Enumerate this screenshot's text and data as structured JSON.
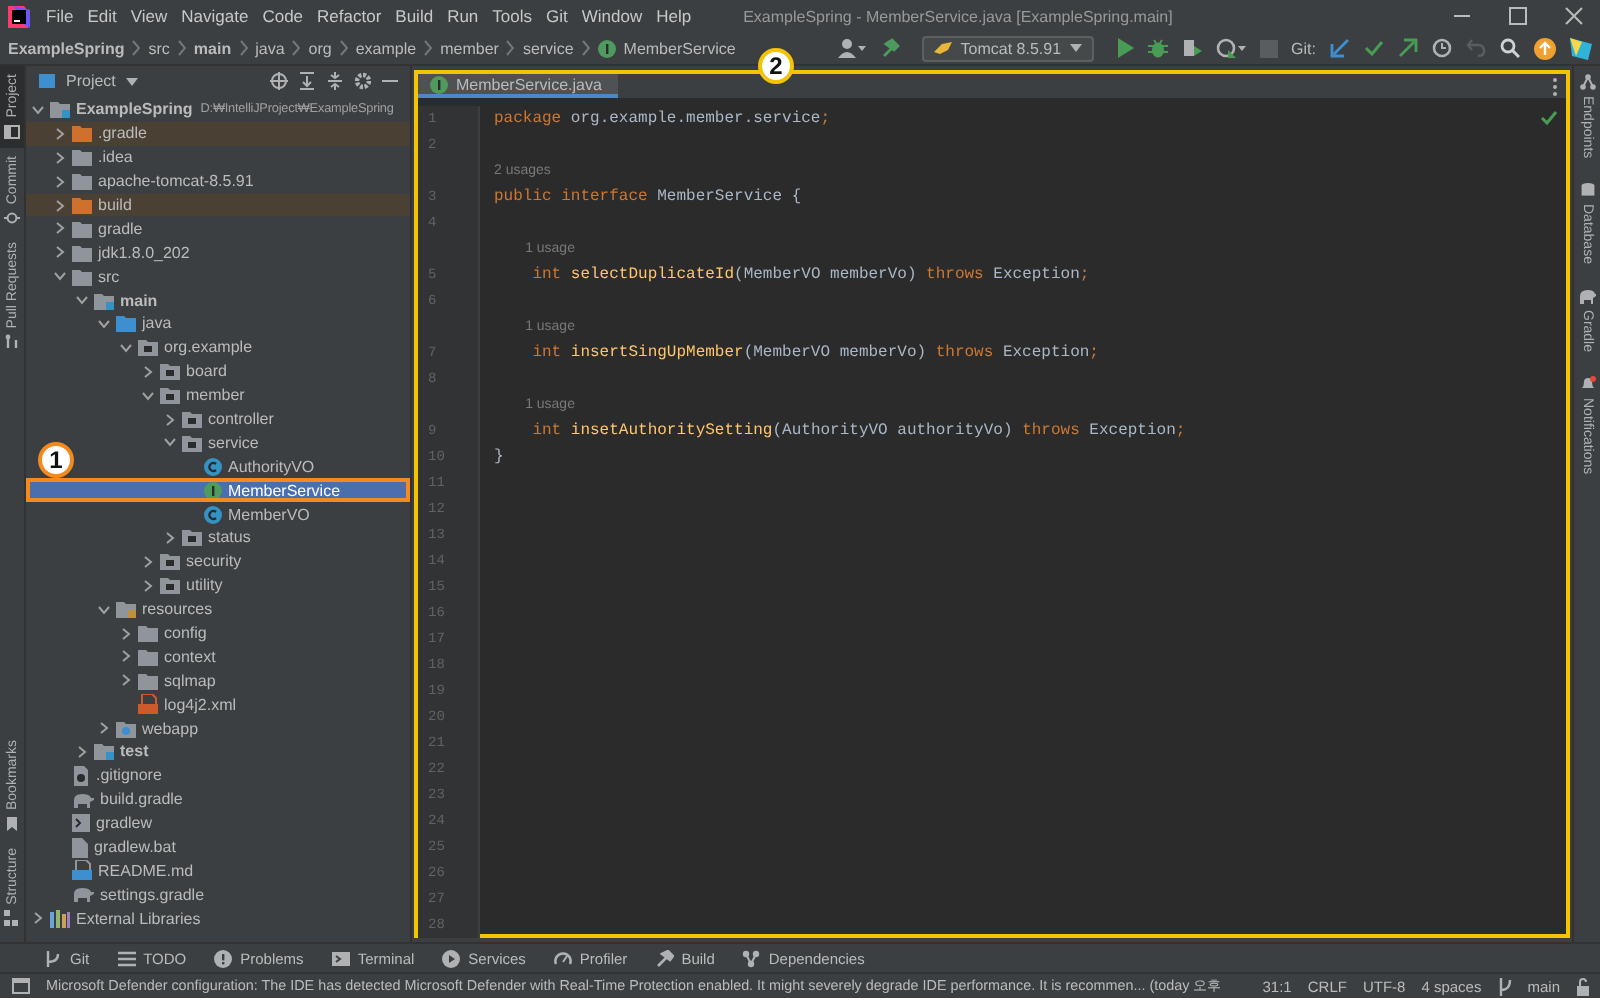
{
  "menu": [
    "File",
    "Edit",
    "View",
    "Navigate",
    "Code",
    "Refactor",
    "Build",
    "Run",
    "Tools",
    "Git",
    "Window",
    "Help"
  ],
  "window": {
    "title": "ExampleSpring - MemberService.java [ExampleSpring.main]"
  },
  "breadcrumbs": [
    {
      "label": "ExampleSpring",
      "kind": "module"
    },
    {
      "label": "src",
      "kind": "plain"
    },
    {
      "label": "main",
      "kind": "module"
    },
    {
      "label": "java",
      "kind": "plain"
    },
    {
      "label": "org",
      "kind": "plain"
    },
    {
      "label": "example",
      "kind": "plain"
    },
    {
      "label": "member",
      "kind": "plain"
    },
    {
      "label": "service",
      "kind": "plain"
    },
    {
      "label": "MemberService",
      "kind": "interface"
    }
  ],
  "toolbar": {
    "run_configuration": "Tomcat 8.5.91",
    "vcs_label": "Git:"
  },
  "left_stripe": [
    {
      "label": "Project",
      "kind": "project",
      "selected": true
    },
    {
      "label": "Commit",
      "kind": "commit",
      "selected": false
    },
    {
      "label": "Pull Requests",
      "kind": "pull",
      "selected": false
    }
  ],
  "left_stripe_bottom": [
    {
      "label": "Bookmarks",
      "kind": "bookmark",
      "selected": false
    },
    {
      "label": "Structure",
      "kind": "structure",
      "selected": false
    }
  ],
  "right_stripe": [
    {
      "label": "Endpoints",
      "kind": "endpoints"
    },
    {
      "label": "Database",
      "kind": "database"
    },
    {
      "label": "Gradle",
      "kind": "gradle"
    },
    {
      "label": "Notifications",
      "kind": "notifications"
    }
  ],
  "project": {
    "title": "Project",
    "tree": [
      {
        "label": "ExampleSpring",
        "detail": "D:₩IntelliJProject₩ExampleSpring",
        "kind": "module",
        "selected": false,
        "expanded": true,
        "children": [
          {
            "label": ".gradle",
            "kind": "excluded",
            "selected": false,
            "expanded": false
          },
          {
            "label": ".idea",
            "kind": "folder",
            "selected": false,
            "expanded": false
          },
          {
            "label": "apache-tomcat-8.5.91",
            "kind": "folder",
            "selected": false,
            "expanded": false
          },
          {
            "label": "build",
            "kind": "excluded",
            "selected": false,
            "expanded": false
          },
          {
            "label": "gradle",
            "kind": "folder",
            "selected": false,
            "expanded": false
          },
          {
            "label": "jdk1.8.0_202",
            "kind": "folder",
            "selected": false,
            "expanded": false
          },
          {
            "label": "src",
            "kind": "folder",
            "selected": false,
            "expanded": true,
            "children": [
              {
                "label": "main",
                "kind": "source-set",
                "selected": false,
                "expanded": true,
                "children": [
                  {
                    "label": "java",
                    "kind": "source-root",
                    "selected": false,
                    "expanded": true,
                    "children": [
                      {
                        "label": "org.example",
                        "kind": "package",
                        "selected": false,
                        "expanded": true,
                        "children": [
                          {
                            "label": "board",
                            "kind": "package",
                            "selected": false,
                            "expanded": false
                          },
                          {
                            "label": "member",
                            "kind": "package",
                            "selected": false,
                            "expanded": true,
                            "children": [
                              {
                                "label": "controller",
                                "kind": "package",
                                "selected": false,
                                "expanded": false
                              },
                              {
                                "label": "service",
                                "kind": "package",
                                "selected": false,
                                "expanded": true,
                                "children": [
                                  {
                                    "label": "AuthorityVO",
                                    "kind": "class",
                                    "selected": false
                                  },
                                  {
                                    "label": "MemberService",
                                    "kind": "interface",
                                    "selected": true
                                  },
                                  {
                                    "label": "MemberVO",
                                    "kind": "class",
                                    "selected": false
                                  }
                                ]
                              },
                              {
                                "label": "status",
                                "kind": "package",
                                "selected": false,
                                "expanded": false
                              }
                            ]
                          },
                          {
                            "label": "security",
                            "kind": "package",
                            "selected": false,
                            "expanded": false
                          },
                          {
                            "label": "utility",
                            "kind": "package",
                            "selected": false,
                            "expanded": false
                          }
                        ]
                      }
                    ]
                  },
                  {
                    "label": "resources",
                    "kind": "resource-root",
                    "selected": false,
                    "expanded": true,
                    "children": [
                      {
                        "label": "config",
                        "kind": "folder",
                        "selected": false,
                        "expanded": false
                      },
                      {
                        "label": "context",
                        "kind": "folder",
                        "selected": false,
                        "expanded": false
                      },
                      {
                        "label": "sqlmap",
                        "kind": "folder",
                        "selected": false,
                        "expanded": false
                      },
                      {
                        "label": "log4j2.xml",
                        "kind": "xml",
                        "selected": false
                      }
                    ]
                  },
                  {
                    "label": "webapp",
                    "kind": "web-folder",
                    "selected": false,
                    "expanded": false
                  }
                ]
              },
              {
                "label": "test",
                "kind": "source-set",
                "selected": false,
                "expanded": false
              }
            ]
          },
          {
            "label": ".gitignore",
            "kind": "ignore-file",
            "selected": false
          },
          {
            "label": "build.gradle",
            "kind": "gradle-file",
            "selected": false
          },
          {
            "label": "gradlew",
            "kind": "script",
            "selected": false
          },
          {
            "label": "gradlew.bat",
            "kind": "text-file",
            "selected": false
          },
          {
            "label": "README.md",
            "kind": "markdown",
            "selected": false
          },
          {
            "label": "settings.gradle",
            "kind": "gradle-file",
            "selected": false
          }
        ]
      },
      {
        "label": "External Libraries",
        "kind": "library",
        "selected": false,
        "expanded": false
      }
    ]
  },
  "editor": {
    "tabs": [
      {
        "label": "MemberService.java",
        "kind": "interface",
        "selected": true
      }
    ],
    "lines": [
      {
        "number": "1",
        "tokens": [
          {
            "kind": "keyword",
            "text": "package"
          },
          {
            "kind": "plain",
            "text": " org.example.member.service"
          },
          {
            "kind": "keyword",
            "text": ";"
          }
        ]
      },
      {
        "number": "2"
      },
      {
        "number": "3",
        "hint": "2 usages",
        "tokens": [
          {
            "kind": "keyword",
            "text": "public interface"
          },
          {
            "kind": "plain",
            "text": " MemberService {"
          }
        ]
      },
      {
        "number": "4"
      },
      {
        "number": "5",
        "hint": "1 usage",
        "tokens": [
          {
            "kind": "keyword",
            "text": "    int "
          },
          {
            "kind": "method",
            "text": "selectDuplicateId"
          },
          {
            "kind": "plain",
            "text": "(MemberVO memberVo) "
          },
          {
            "kind": "keyword",
            "text": "throws"
          },
          {
            "kind": "plain",
            "text": " Exception"
          },
          {
            "kind": "keyword",
            "text": ";"
          }
        ]
      },
      {
        "number": "6"
      },
      {
        "number": "7",
        "hint": "1 usage",
        "tokens": [
          {
            "kind": "keyword",
            "text": "    int "
          },
          {
            "kind": "method",
            "text": "insertSingUpMember"
          },
          {
            "kind": "plain",
            "text": "(MemberVO memberVo) "
          },
          {
            "kind": "keyword",
            "text": "throws"
          },
          {
            "kind": "plain",
            "text": " Exception"
          },
          {
            "kind": "keyword",
            "text": ";"
          }
        ]
      },
      {
        "number": "8"
      },
      {
        "number": "9",
        "hint": "1 usage",
        "tokens": [
          {
            "kind": "keyword",
            "text": "    int "
          },
          {
            "kind": "method",
            "text": "insetAuthoritySetting"
          },
          {
            "kind": "plain",
            "text": "(AuthorityVO authorityVo) "
          },
          {
            "kind": "keyword",
            "text": "throws"
          },
          {
            "kind": "plain",
            "text": " Exception"
          },
          {
            "kind": "keyword",
            "text": ";"
          }
        ]
      },
      {
        "number": "10",
        "tokens": [
          {
            "kind": "plain",
            "text": "}"
          }
        ]
      },
      {
        "number": "11"
      },
      {
        "number": "12"
      },
      {
        "number": "13"
      },
      {
        "number": "14"
      },
      {
        "number": "15"
      },
      {
        "number": "16"
      },
      {
        "number": "17"
      },
      {
        "number": "18"
      },
      {
        "number": "19"
      },
      {
        "number": "20"
      },
      {
        "number": "21"
      },
      {
        "number": "22"
      },
      {
        "number": "23"
      },
      {
        "number": "24"
      },
      {
        "number": "25"
      },
      {
        "number": "26"
      },
      {
        "number": "27"
      },
      {
        "number": "28"
      }
    ]
  },
  "callouts": [
    {
      "label": "1",
      "color": "#f28a1e"
    },
    {
      "label": "2",
      "color": "#f5c400"
    }
  ],
  "tool_windows": [
    {
      "label": "Git",
      "kind": "git"
    },
    {
      "label": "TODO",
      "kind": "todo"
    },
    {
      "label": "Problems",
      "kind": "problems"
    },
    {
      "label": "Terminal",
      "kind": "terminal"
    },
    {
      "label": "Services",
      "kind": "services"
    },
    {
      "label": "Profiler",
      "kind": "profiler"
    },
    {
      "label": "Build",
      "kind": "build"
    },
    {
      "label": "Dependencies",
      "kind": "dependencies"
    }
  ],
  "status_bar": {
    "message": "Microsoft Defender configuration: The IDE has detected Microsoft Defender with Real-Time Protection enabled. It might severely degrade IDE performance. It is recommen... (today 오후",
    "position": "31:1",
    "line_separator": "CRLF",
    "encoding": "UTF-8",
    "indent": "4 spaces",
    "branch": "main"
  }
}
